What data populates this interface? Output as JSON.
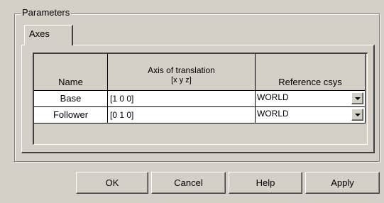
{
  "parameters": {
    "group_title": "Parameters",
    "tabs": [
      {
        "label": "Axes",
        "selected": true
      }
    ]
  },
  "table": {
    "headers": {
      "name": "Name",
      "axis_line1": "Axis of translation",
      "axis_line2": "[x y z]",
      "reference": "Reference csys"
    },
    "rows": [
      {
        "name": "Base",
        "axis": "[1 0 0]",
        "reference": "WORLD"
      },
      {
        "name": "Follower",
        "axis": "[0 1 0]",
        "reference": "WORLD"
      }
    ]
  },
  "buttons": {
    "ok": "OK",
    "cancel": "Cancel",
    "help": "Help",
    "apply": "Apply"
  },
  "colors": {
    "face": "#d4d0c8",
    "cell_background": "#ffffff"
  }
}
